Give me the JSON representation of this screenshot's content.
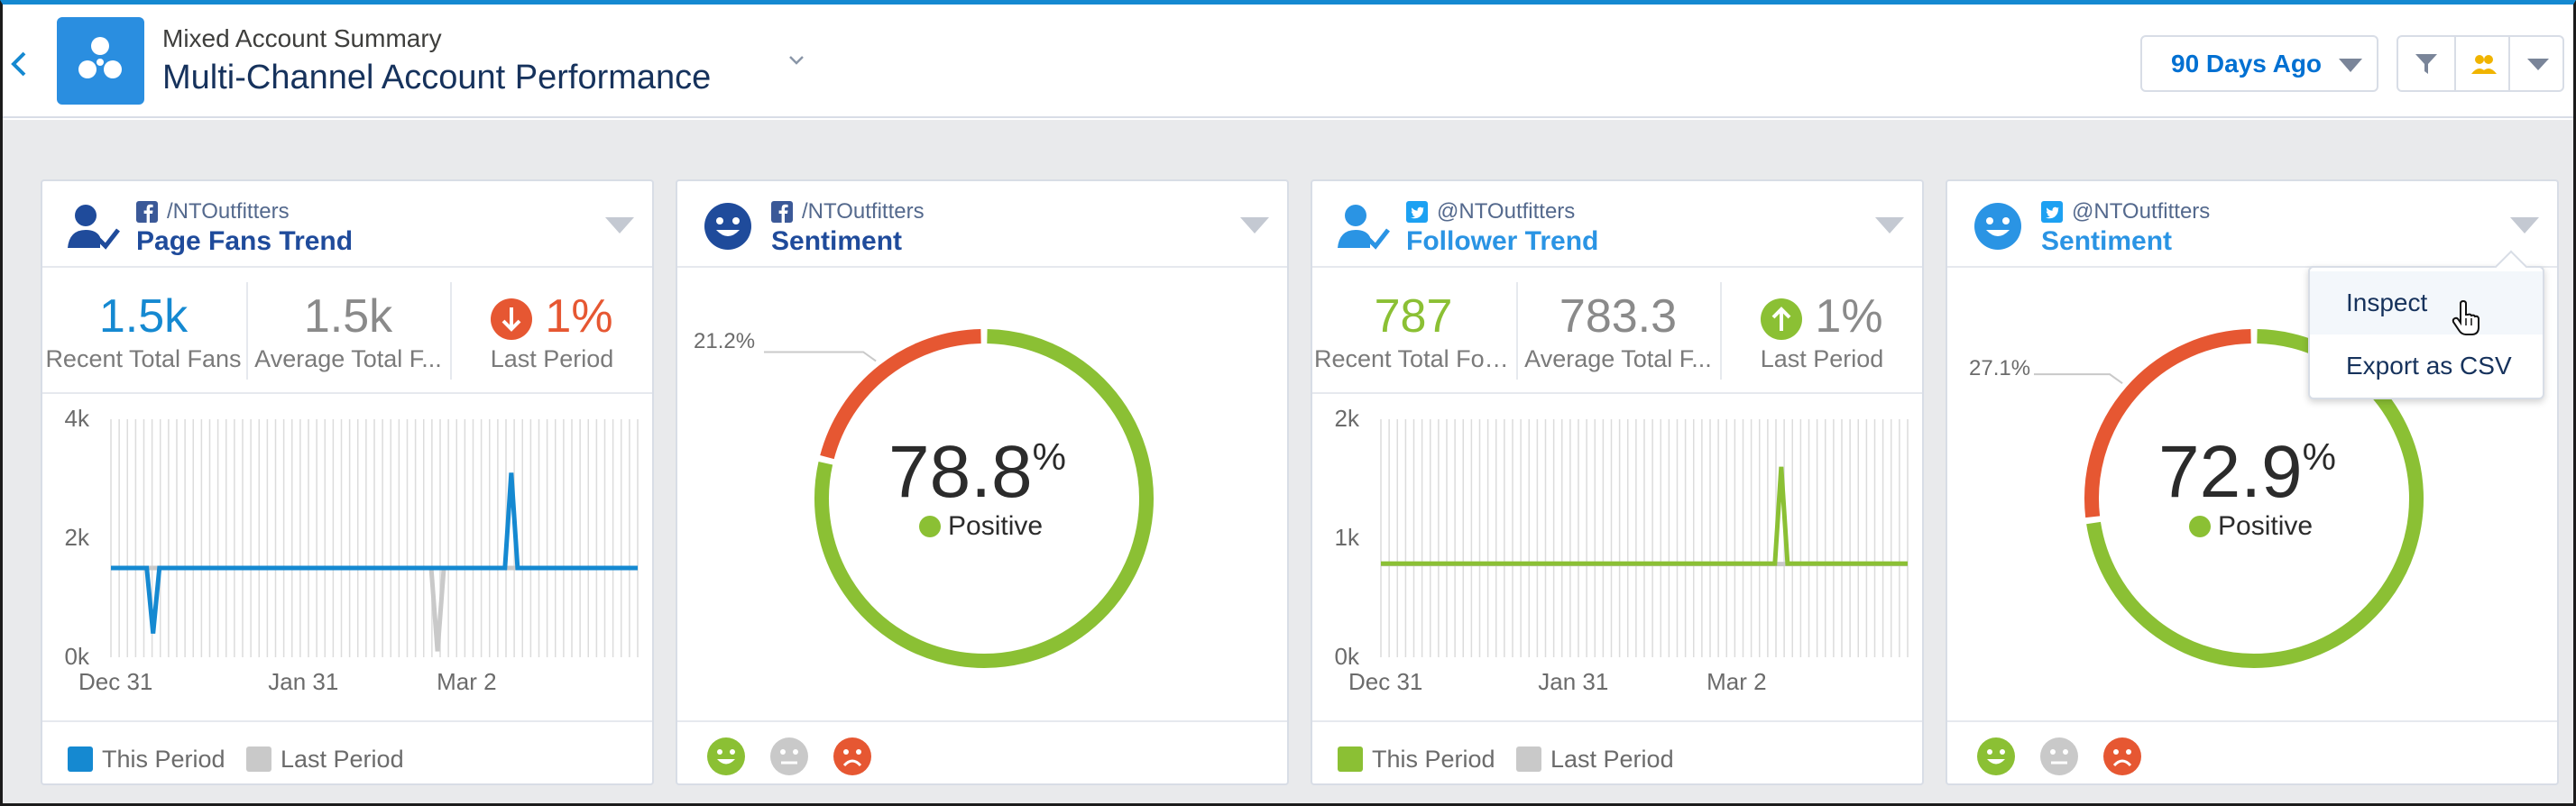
{
  "header": {
    "subtitle": "Mixed Account Summary",
    "title": "Multi-Channel Account Performance",
    "period_label": "90 Days Ago"
  },
  "icons": {
    "back": "chevron-left-icon",
    "app": "community-icon",
    "title_dropdown": "chevron-down-icon",
    "filter": "filter-icon",
    "group": "group-icon",
    "more": "caret-down-icon"
  },
  "colors": {
    "accent": "#1589d1",
    "facebook_blue": "#1f4b9b",
    "twitter_blue": "#2a94e4",
    "positive": "#8bc034",
    "negative": "#e65732",
    "neutral": "#c9c9c9"
  },
  "cards": [
    {
      "handle": "/NTOutfitters",
      "title": "Page Fans Trend",
      "source": "facebook",
      "metrics": [
        {
          "value": "1.5k",
          "label": "Recent Total Fans"
        },
        {
          "value": "1.5k",
          "label": "Average Total F..."
        },
        {
          "value": "1%",
          "label": "Last Period",
          "direction": "down"
        }
      ],
      "legend": [
        "This Period",
        "Last Period"
      ]
    },
    {
      "handle": "/NTOutfitters",
      "title": "Sentiment",
      "source": "facebook",
      "positive_pct": "78.8",
      "pct_sign": "%",
      "positive_label": "Positive",
      "negative_pct_label": "21.2%"
    },
    {
      "handle": "@NTOutfitters",
      "title": "Follower Trend",
      "source": "twitter",
      "metrics": [
        {
          "value": "787",
          "label": "Recent Total Foll..."
        },
        {
          "value": "783.3",
          "label": "Average Total F..."
        },
        {
          "value": "1%",
          "label": "Last Period",
          "direction": "up"
        }
      ],
      "legend": [
        "This Period",
        "Last Period"
      ]
    },
    {
      "handle": "@NTOutfitters",
      "title": "Sentiment",
      "source": "twitter",
      "positive_pct": "72.9",
      "pct_sign": "%",
      "positive_label": "Positive",
      "negative_pct_label": "27.1%"
    }
  ],
  "dropdown": {
    "items": [
      "Inspect",
      "Export as CSV"
    ]
  },
  "chart_data": [
    {
      "type": "line",
      "x_tick_labels": [
        "Dec 31",
        "Jan 31",
        "Mar 2"
      ],
      "y_tick_labels": [
        "4k",
        "2k",
        "0k"
      ],
      "ylim": [
        0,
        4000
      ],
      "series": [
        {
          "name": "This Period",
          "color": "#1589d1",
          "baseline": 1500,
          "spikes": [
            {
              "at": 0.08,
              "value": 400
            },
            {
              "at": 0.76,
              "value": 3100
            }
          ]
        },
        {
          "name": "Last Period",
          "color": "#c9c9c9",
          "baseline": 1500,
          "spikes": [
            {
              "at": 0.62,
              "value": 100
            }
          ]
        }
      ]
    },
    {
      "type": "pie",
      "title": "Sentiment",
      "labels": [
        "Positive",
        "Negative"
      ],
      "values": [
        78.8,
        21.2
      ],
      "colors": [
        "#8bc034",
        "#e65732"
      ]
    },
    {
      "type": "line",
      "x_tick_labels": [
        "Dec 31",
        "Jan 31",
        "Mar 2"
      ],
      "y_tick_labels": [
        "2k",
        "1k",
        "0k"
      ],
      "ylim": [
        0,
        2000
      ],
      "series": [
        {
          "name": "This Period",
          "color": "#8bc034",
          "baseline": 787,
          "spikes": [
            {
              "at": 0.76,
              "value": 1600
            }
          ]
        },
        {
          "name": "Last Period",
          "color": "#c9c9c9",
          "baseline": 783
        }
      ]
    },
    {
      "type": "pie",
      "title": "Sentiment",
      "labels": [
        "Positive",
        "Negative"
      ],
      "values": [
        72.9,
        27.1
      ],
      "colors": [
        "#8bc034",
        "#e65732"
      ]
    }
  ]
}
